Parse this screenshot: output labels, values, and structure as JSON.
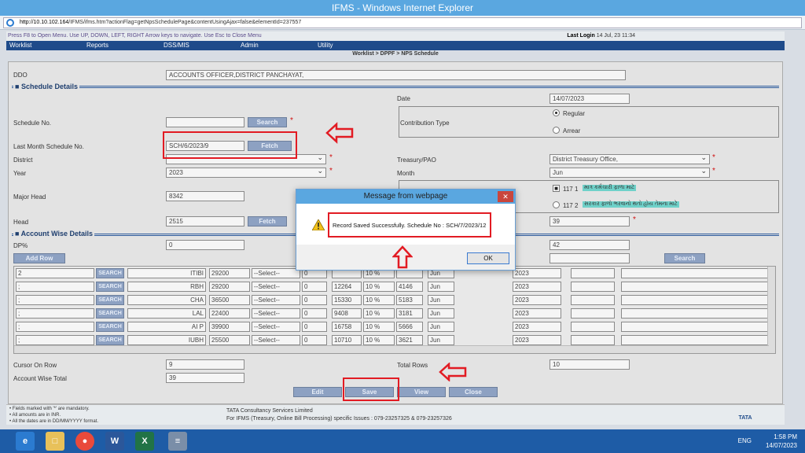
{
  "window": {
    "title": "IFMS - Windows Internet Explorer",
    "url_host": "http://10.10.102.164",
    "url_path": "/IFMS/ifms.htm?actionFlag=getNpsSchedulePage&contentUsingAjax=false&elementId=237557"
  },
  "header": {
    "help_text": "Press F8 to Open Menu. Use UP, DOWN, LEFT, RIGHT Arrow keys to navigate. Use Esc to Close Menu",
    "last_login_label": "Last Login",
    "last_login_value": "14 Jul, 23 11:34"
  },
  "menu": [
    "Worklist",
    "Reports",
    "DSS/MIS",
    "Admin",
    "Utility"
  ],
  "breadcrumb": "Worklist > DPPF > NPS Schedule",
  "form": {
    "ddo_label": "DDO",
    "ddo_value": "ACCOUNTS OFFICER,DISTRICT PANCHAYAT,",
    "schedule_details_title": "Schedule Details",
    "date_label": "Date",
    "date_value": "14/07/2023",
    "schedule_no_label": "Schedule No.",
    "search_button": "Search",
    "contribution_type_label": "Contribution Type",
    "regular_label": "Regular",
    "arrear_label": "Arrear",
    "last_month_label": "Last Month Schedule No.",
    "last_month_value": "SCH/6/2023/9",
    "fetch_button": "Fetch",
    "district_label": "District",
    "treasury_label": "Treasury/PAO",
    "treasury_value": "District Treasury Office,",
    "year_label": "Year",
    "year_value": "2023",
    "month_label": "Month",
    "month_value": "Jun",
    "major_head_label": "Major Head",
    "major_head_value": "8342",
    "opt1_code": "117 1",
    "opt1_text": "માત્ર કર્મચારી ફાળા માટે",
    "opt2_code": "117 2",
    "opt2_text": "સરકાર ફાળો ભરવાનો થતો હોય તેમના માટે",
    "head_label": "Head",
    "head_value": "2515",
    "head_fetch_button": "Fetch",
    "head_right_value": "39",
    "account_wise_title": "Account Wise Details",
    "dp_label": "DP%",
    "dp_value": "0",
    "dp_right_value": "42",
    "add_row_button": "Add Row",
    "search2_button": "Search",
    "cursor_label": "Cursor On Row",
    "cursor_value": "9",
    "total_rows_label": "Total Rows",
    "total_rows_value": "10",
    "account_total_label": "Account Wise Total",
    "account_total_value": "39"
  },
  "grid": {
    "search_label": "SEARCH",
    "select_placeholder": "--Select--",
    "rows": [
      {
        "c1": "2",
        "c2": "ITIBI",
        "c3": "29200",
        "c5": "0",
        "c6": "",
        "c7": "10 %",
        "c8": "",
        "c9": "Jun",
        "c10": "2023"
      },
      {
        "c1": ";",
        "c2": "RBH",
        "c3": "29200",
        "c5": "0",
        "c6": "12264",
        "c7": "10 %",
        "c8": "4146",
        "c9": "Jun",
        "c10": "2023"
      },
      {
        "c1": ";",
        "c2": "CHA",
        "c3": "36500",
        "c5": "0",
        "c6": "15330",
        "c7": "10 %",
        "c8": "5183",
        "c9": "Jun",
        "c10": "2023"
      },
      {
        "c1": ";",
        "c2": "LAL",
        "c3": "22400",
        "c5": "0",
        "c6": "9408",
        "c7": "10 %",
        "c8": "3181",
        "c9": "Jun",
        "c10": "2023"
      },
      {
        "c1": ";",
        "c2": "AI P",
        "c3": "39900",
        "c5": "0",
        "c6": "16758",
        "c7": "10 %",
        "c8": "5666",
        "c9": "Jun",
        "c10": "2023"
      },
      {
        "c1": ";",
        "c2": "IUBH",
        "c3": "25500",
        "c5": "0",
        "c6": "10710",
        "c7": "10 %",
        "c8": "3621",
        "c9": "Jun",
        "c10": "2023"
      }
    ]
  },
  "actions": {
    "edit": "Edit",
    "save": "Save",
    "view": "View",
    "close": "Close"
  },
  "footer": {
    "note1": "Fields marked with '*' are mandatory.",
    "note2": "All amounts are in INR.",
    "note3": "All the dates are in DD/MM/YYYY format.",
    "tcs": "TATA Consultancy Services Limited",
    "support": "For IFMS (Treasury, Online Bill Processing) specific Issues : 079-23257325 & 079-23257326",
    "logo": "TATA"
  },
  "dialog": {
    "title": "Message from webpage",
    "message": "Record Saved Successfully. Schedule No : SCH/7/2023/12",
    "ok": "OK"
  },
  "taskbar": {
    "time": "1:58 PM",
    "date": "14/07/2023",
    "lang": "ENG"
  },
  "colors": {
    "annotation": "#e21b23",
    "menu": "#1f4b8a",
    "titlebar": "#5aa7e0"
  }
}
